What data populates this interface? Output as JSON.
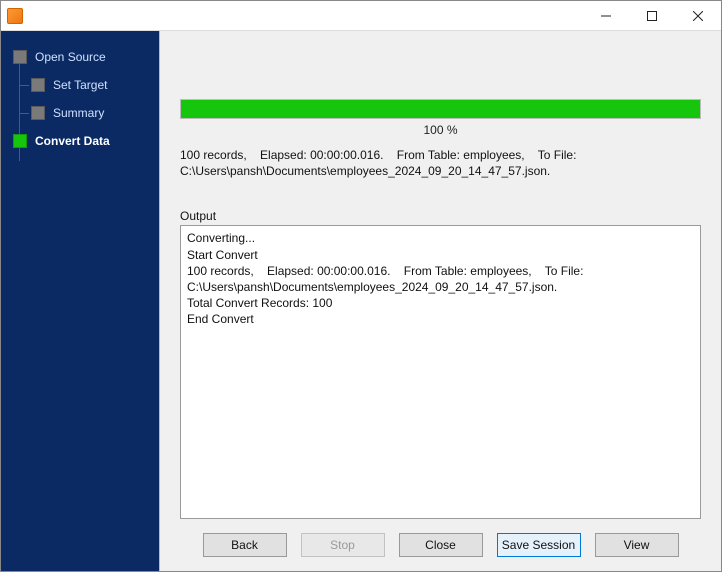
{
  "window": {
    "title": ""
  },
  "sidebar": {
    "steps": [
      {
        "label": "Open Source"
      },
      {
        "label": "Set Target"
      },
      {
        "label": "Summary"
      },
      {
        "label": "Convert Data"
      }
    ]
  },
  "progress": {
    "percent_label": "100 %",
    "fill_percent": 100
  },
  "status": "100 records,    Elapsed: 00:00:00.016.    From Table: employees,    To File: C:\\Users\\pansh\\Documents\\employees_2024_09_20_14_47_57.json.",
  "output": {
    "label": "Output",
    "log": "Converting...\nStart Convert\n100 records,    Elapsed: 00:00:00.016.    From Table: employees,    To File: C:\\Users\\pansh\\Documents\\employees_2024_09_20_14_47_57.json.\nTotal Convert Records: 100\nEnd Convert"
  },
  "buttons": {
    "back": "Back",
    "stop": "Stop",
    "close": "Close",
    "save_session": "Save Session",
    "view": "View"
  }
}
